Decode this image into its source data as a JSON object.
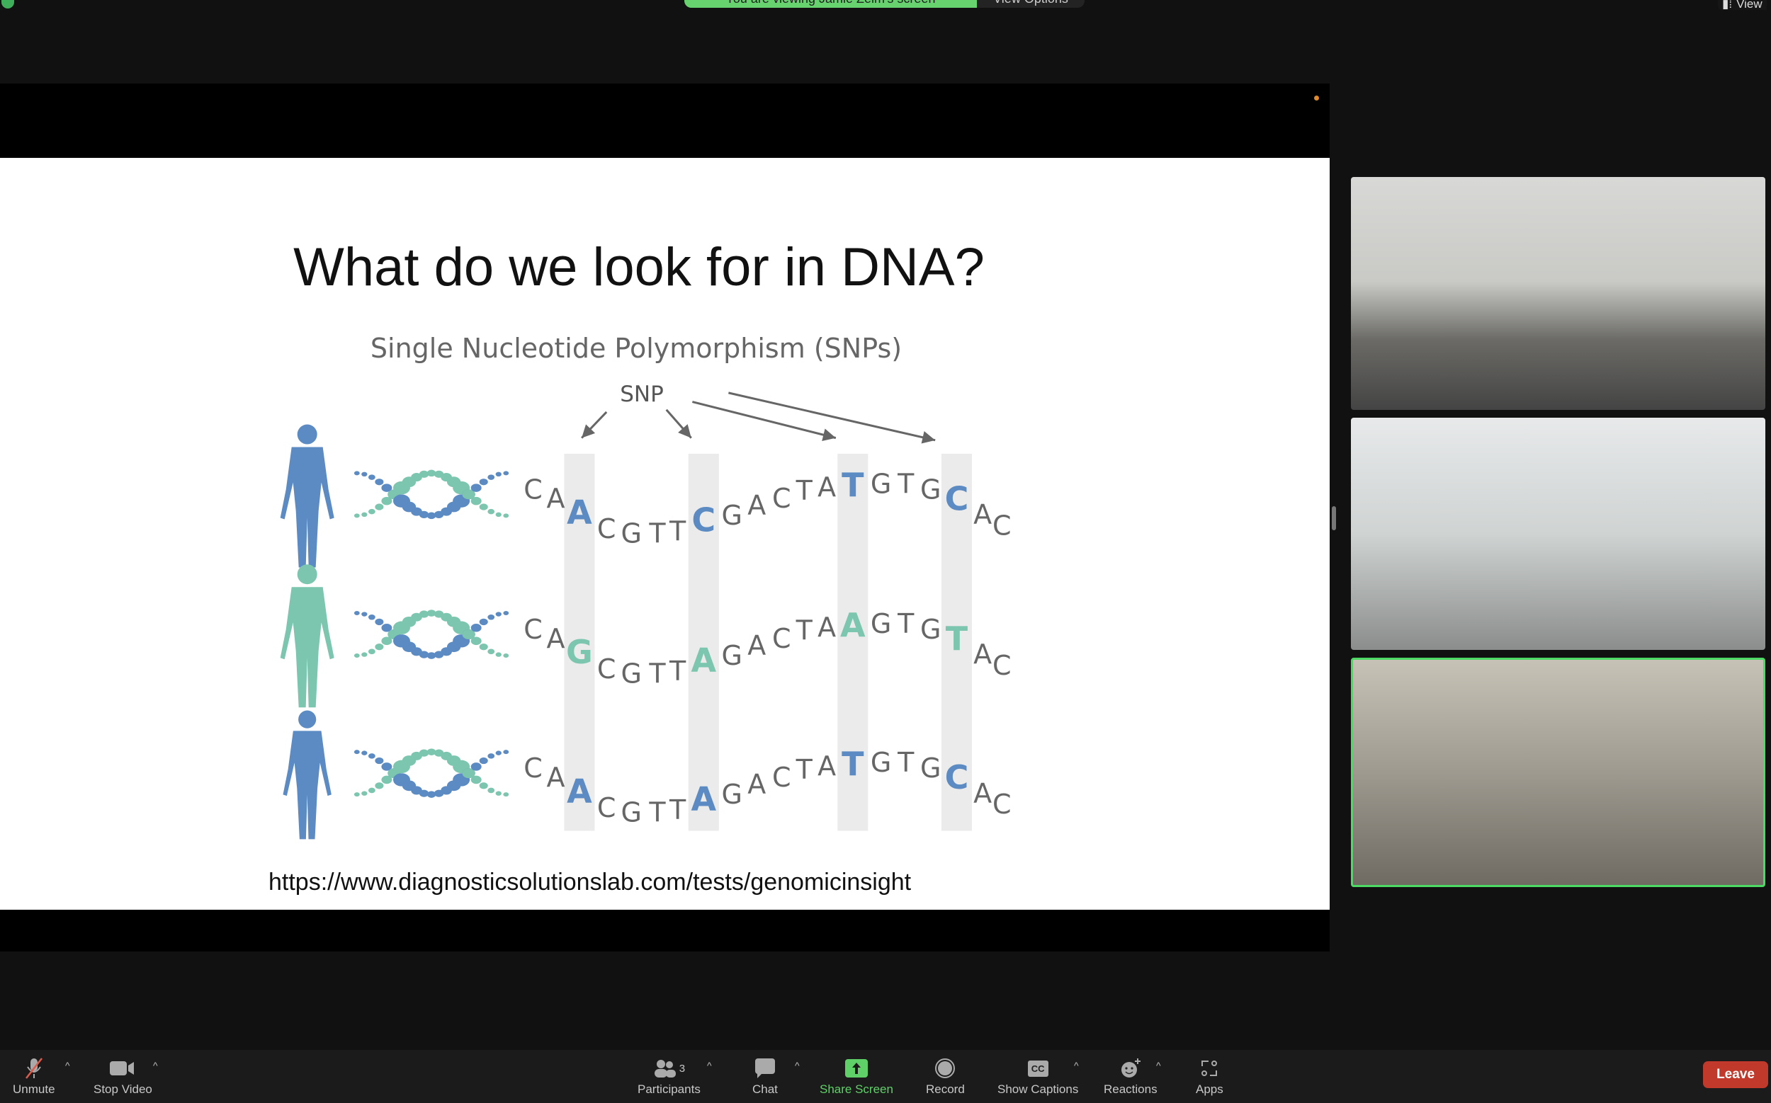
{
  "top_bar": {
    "banner_text": "You are viewing Jamie Zelm's screen",
    "view_options_label": "View Options",
    "view_label": "View"
  },
  "slide": {
    "title": "What do we look for in DNA?",
    "subtitle": "Single Nucleotide Polymorphism (SNPs)",
    "snp_label": "SNP",
    "url": "https://www.diagnosticsolutionslab.com/tests/genomicinsight",
    "colors": {
      "blue": "#5b8bc2",
      "teal": "#7cc5ae",
      "letter": "#666666",
      "column": "#ebebeb"
    },
    "sequences": [
      {
        "figure_color": "blue",
        "letters": [
          "C",
          "A",
          "A",
          "C",
          "G",
          "T",
          "T",
          "C",
          "G",
          "A",
          "C",
          "T",
          "A",
          "T",
          "G",
          "T",
          "G",
          "C",
          "A",
          "C"
        ],
        "snp_colors": [
          "blue",
          "blue",
          "blue",
          "blue"
        ]
      },
      {
        "figure_color": "teal",
        "letters": [
          "C",
          "A",
          "G",
          "C",
          "G",
          "T",
          "T",
          "A",
          "G",
          "A",
          "C",
          "T",
          "A",
          "A",
          "G",
          "T",
          "G",
          "T",
          "A",
          "C"
        ],
        "snp_colors": [
          "teal",
          "teal",
          "teal",
          "teal"
        ]
      },
      {
        "figure_color": "blue",
        "letters": [
          "C",
          "A",
          "A",
          "C",
          "G",
          "T",
          "T",
          "A",
          "G",
          "A",
          "C",
          "T",
          "A",
          "T",
          "G",
          "T",
          "G",
          "C",
          "A",
          "C"
        ],
        "snp_colors": [
          "blue",
          "blue",
          "blue",
          "blue"
        ]
      }
    ]
  },
  "participants": [
    {
      "tile": "classroom"
    },
    {
      "tile": "lab-presenter-headset"
    },
    {
      "tile": "lab-speaker",
      "active": true
    }
  ],
  "toolbar": {
    "unmute": "Unmute",
    "stop_video": "Stop Video",
    "participants": "Participants",
    "participant_count": "3",
    "chat": "Chat",
    "share_screen": "Share Screen",
    "record": "Record",
    "show_captions": "Show Captions",
    "captions_icon": "CC",
    "reactions": "Reactions",
    "apps": "Apps",
    "leave": "Leave",
    "share_color": "#5fd068",
    "leave_color": "#c0392b"
  }
}
